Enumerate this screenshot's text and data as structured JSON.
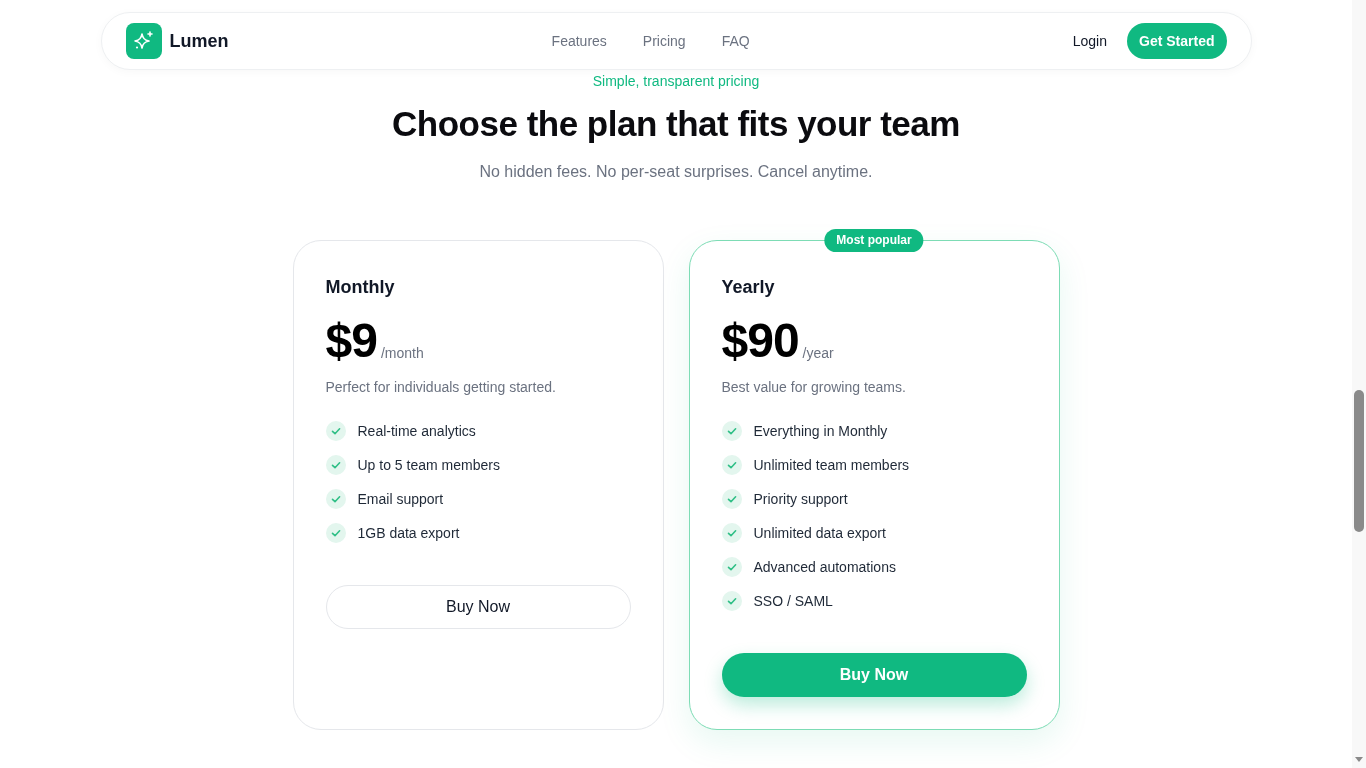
{
  "nav": {
    "brand": "Lumen",
    "links": [
      "Features",
      "Pricing",
      "FAQ"
    ],
    "login": "Login",
    "cta": "Get Started"
  },
  "hero": {
    "eyebrow": "Simple, transparent pricing",
    "title": "Choose the plan that fits your team",
    "subtitle": "No hidden fees. No per-seat surprises. Cancel anytime."
  },
  "plans": [
    {
      "name": "Monthly",
      "highlighted": false,
      "price": "$9",
      "period": "/month",
      "description": "Perfect for individuals getting started.",
      "features": [
        "Real-time analytics",
        "Up to 5 team members",
        "Email support",
        "1GB data export"
      ],
      "button": "Buy Now"
    },
    {
      "name": "Yearly",
      "highlighted": true,
      "badge": "Most popular",
      "price": "$90",
      "period": "/year",
      "description": "Best value for growing teams.",
      "features": [
        "Everything in Monthly",
        "Unlimited team members",
        "Priority support",
        "Unlimited data export",
        "Advanced automations",
        "SSO / SAML"
      ],
      "button": "Buy Now"
    }
  ]
}
